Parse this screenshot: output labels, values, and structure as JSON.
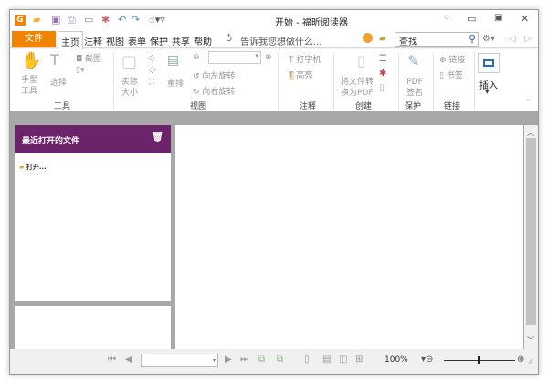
{
  "window": {
    "title": "开始 - 福昕阅读器",
    "controls": [
      "restore-layout",
      "minimize",
      "maximize",
      "close"
    ]
  },
  "menu": {
    "file": "文件",
    "tabs": [
      "主页",
      "注释",
      "视图",
      "表单",
      "保护",
      "共享",
      "帮助"
    ],
    "active": "主页",
    "tell_me": "告诉我您想做什么...",
    "search_placeholder": "查找"
  },
  "ribbon": {
    "tools": {
      "hand": "手型\n工具",
      "select": "选择",
      "snapshot": "截图",
      "group": "工具"
    },
    "view": {
      "actual_size": "实际\n大小",
      "reflow": "重排",
      "rotate_left": "向左旋转",
      "rotate_right": "向右旋转",
      "group": "视图"
    },
    "comment": {
      "typewriter": "打字机",
      "highlight": "高亮",
      "group": "注释"
    },
    "create": {
      "convert": "将文件转\n换为PDF",
      "group": "创建"
    },
    "protect": {
      "sign": "PDF\n签名",
      "group": "保护"
    },
    "links": {
      "link": "链接",
      "bookmark": "书签",
      "group": "链接"
    },
    "insert": {
      "label": "插入"
    }
  },
  "recent": {
    "title": "最近打开的文件",
    "open": "打开..."
  },
  "status": {
    "zoom": "100%",
    "zoom_slider": 0.5
  },
  "colors": {
    "file_tab": "#f08300",
    "recent_header": "#6b2469"
  }
}
